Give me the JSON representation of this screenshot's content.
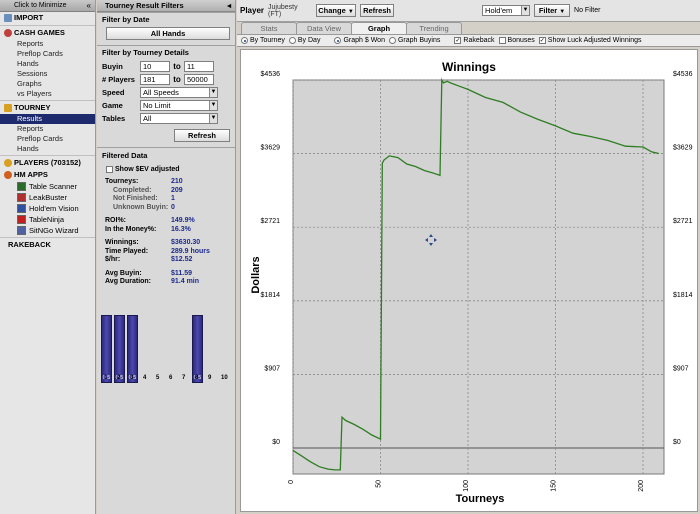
{
  "nav": {
    "minimize": "Click to Minimize",
    "import": "IMPORT",
    "cash_games": "CASH GAMES",
    "cash_items": [
      "Reports",
      "Preflop Cards",
      "Hands",
      "Sessions",
      "Graphs",
      "vs Players"
    ],
    "tourney": "TOURNEY",
    "tourney_items": [
      "Results",
      "Reports",
      "Preflop Cards",
      "Hands"
    ],
    "players": "PLAYERS (703152)",
    "hm_apps": "HM APPS",
    "apps": [
      "Table Scanner",
      "LeakBuster",
      "Hold'em Vision",
      "TableNinja",
      "SitNGo Wizard"
    ],
    "rakeback": "RAKEBACK"
  },
  "filters": {
    "title": "Tourney Result Filters",
    "by_date": "Filter by Date",
    "all_hands": "All Hands",
    "by_details": "Filter by Tourney Details",
    "buyin_label": "Buyin",
    "buyin_min": "10",
    "buyin_to": "to",
    "buyin_max": "11",
    "players_label": "# Players",
    "players_min": "181",
    "players_to": "to",
    "players_max": "50000",
    "speed_label": "Speed",
    "speed_value": "All Speeds",
    "game_label": "Game",
    "game_value": "No Limit",
    "tables_label": "Tables",
    "tables_value": "All",
    "refresh": "Refresh",
    "filtered_data": "Filtered Data",
    "show_sev": "Show $EV adjusted",
    "stats": {
      "tourneys_k": "Tourneys:",
      "tourneys_v": "210",
      "completed_k": "Completed:",
      "completed_v": "209",
      "notfinished_k": "Not Finished:",
      "notfinished_v": "1",
      "unknown_k": "Unknown Buyin:",
      "unknown_v": "0",
      "roi_k": "ROI%:",
      "roi_v": "149.9%",
      "itm_k": "In the Money%:",
      "itm_v": "16.3%",
      "winnings_k": "Winnings:",
      "winnings_v": "$3630.30",
      "time_k": "Time Played:",
      "time_v": "289.9 hours",
      "hr_k": "$/hr:",
      "hr_v": "$12.52",
      "avgbuyin_k": "Avg Buyin:",
      "avgbuyin_v": "$11.59",
      "avgdur_k": "Avg Duration:",
      "avgdur_v": "91.4 min"
    },
    "histogram": {
      "labels": [
        "1",
        "2",
        "3",
        "4",
        "5",
        "6",
        "7",
        "8",
        "9",
        "10"
      ],
      "values": [
        1,
        1,
        1,
        0,
        0,
        0,
        0,
        1,
        0,
        0
      ],
      "bar_label": "0.5"
    }
  },
  "topbar": {
    "player_label": "Player",
    "player_name": "Jujubesty (FT)",
    "change": "Change",
    "refresh": "Refresh",
    "game_select": "Hold'em",
    "filter": "Filter",
    "no_filter": "No Filter"
  },
  "tabs": [
    "Stats",
    "Data View",
    "Graph",
    "Trending"
  ],
  "options": {
    "by_tourney": "By Tourney",
    "by_day": "By Day",
    "graph_won": "Graph $ Won",
    "graph_buyins": "Graph Buyins",
    "rakeback": "Rakeback",
    "bonuses": "Bonuses",
    "luck": "Show Luck Adjusted Winnings"
  },
  "colors": {
    "line": "#2e7d22",
    "nav_selected": "#1d2a6e",
    "bar": "#3a37a0"
  },
  "chart_data": {
    "type": "line",
    "title": "Winnings",
    "xlabel": "Tourneys",
    "ylabel": "Dollars",
    "xlim": [
      0,
      212
    ],
    "ylim": [
      0,
      4536
    ],
    "yticks": [
      0,
      907,
      1814,
      2721,
      3629,
      4536
    ],
    "ytick_labels": [
      "$0",
      "$907",
      "$1814",
      "$2721",
      "$3629",
      "$4536"
    ],
    "xticks": [
      0,
      50,
      100,
      150,
      200
    ],
    "grid": true,
    "series": [
      {
        "x": [
          0,
          5,
          10,
          15,
          20,
          24,
          27,
          28,
          30,
          35,
          40,
          45,
          50,
          51,
          52,
          55,
          60,
          65,
          70,
          75,
          80,
          84,
          85,
          86,
          88,
          90,
          95,
          100,
          105,
          110,
          120,
          130,
          140,
          150,
          160,
          170,
          180,
          190,
          200,
          205,
          209
        ],
        "y": [
          -30,
          -100,
          -170,
          -230,
          -260,
          -270,
          -270,
          380,
          340,
          290,
          230,
          160,
          110,
          3510,
          3550,
          3600,
          3580,
          3500,
          3470,
          3420,
          3390,
          3360,
          4536,
          4500,
          4520,
          4500,
          4460,
          4420,
          4370,
          4320,
          4260,
          4140,
          4050,
          3970,
          3880,
          3840,
          3790,
          3720,
          3710,
          3650,
          3630
        ]
      }
    ]
  }
}
